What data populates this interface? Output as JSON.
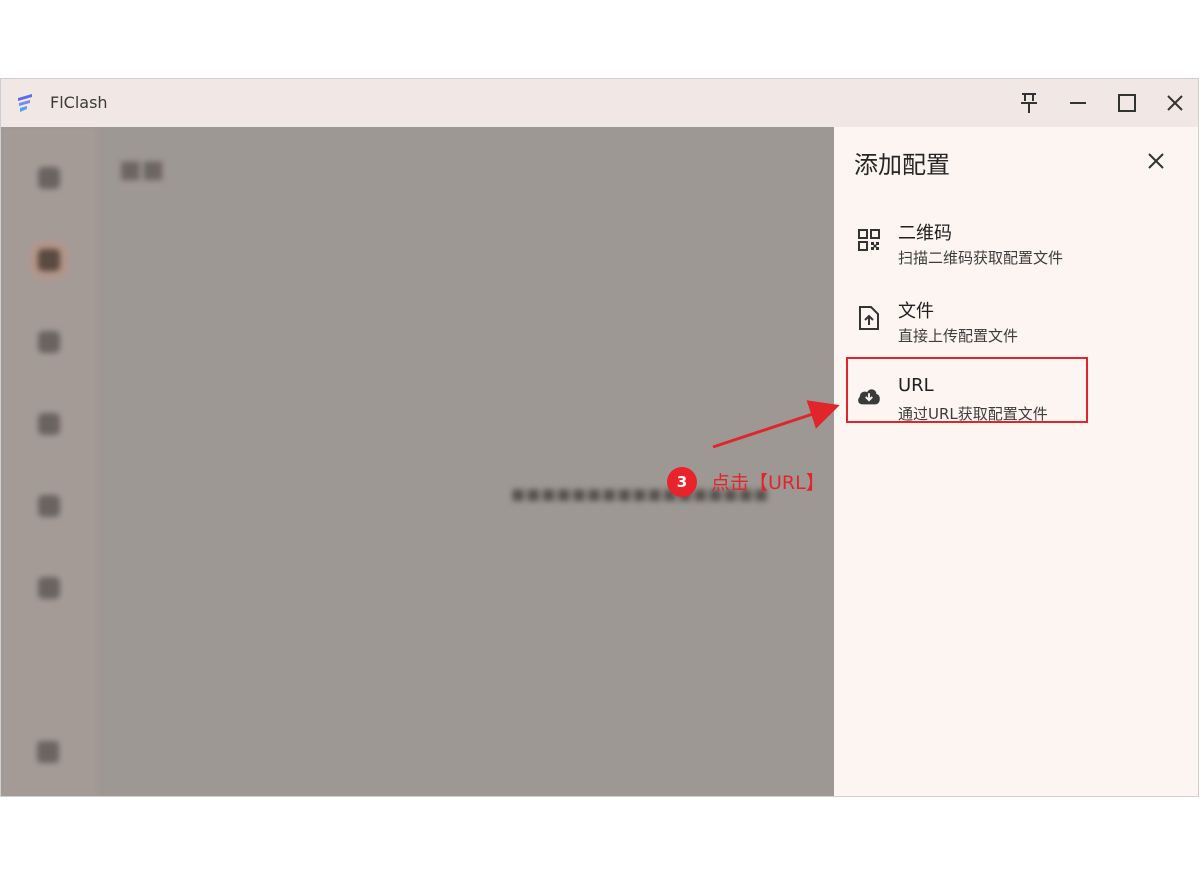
{
  "window": {
    "title": "FlClash"
  },
  "titlebar": {
    "buttons": [
      {
        "name": "pin-button",
        "icon": "pin-icon"
      },
      {
        "name": "minimize-button",
        "icon": "minimize-icon"
      },
      {
        "name": "maximize-button",
        "icon": "maximize-icon"
      },
      {
        "name": "close-button",
        "icon": "close-icon"
      }
    ]
  },
  "panel": {
    "title": "添加配置",
    "options": [
      {
        "title": "二维码",
        "subtitle": "扫描二维码获取配置文件",
        "icon": "qr-code-icon"
      },
      {
        "title": "文件",
        "subtitle": "直接上传配置文件",
        "icon": "file-upload-icon"
      },
      {
        "title": "URL",
        "subtitle": "通过URL获取配置文件",
        "icon": "cloud-download-icon"
      }
    ]
  },
  "annotation": {
    "step": "3",
    "text": "点击【URL】",
    "color": "#e0252d"
  },
  "colors": {
    "accent": "#e0252d",
    "panel_bg": "#fcf5f2",
    "logo": "#5b6cf0"
  }
}
